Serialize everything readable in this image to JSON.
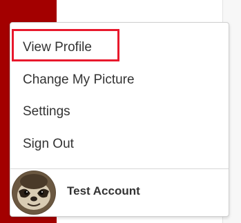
{
  "colors": {
    "accent_red": "#a30000",
    "highlight_red": "#e8182c",
    "text": "#333333"
  },
  "menu": {
    "items": [
      {
        "label": "View Profile",
        "icon": "none"
      },
      {
        "label": "Change My Picture",
        "icon": "none"
      },
      {
        "label": "Settings",
        "icon": "none"
      },
      {
        "label": "Sign Out",
        "icon": "none"
      }
    ]
  },
  "account": {
    "name": "Test Account",
    "avatar_icon": "sloth-avatar"
  }
}
